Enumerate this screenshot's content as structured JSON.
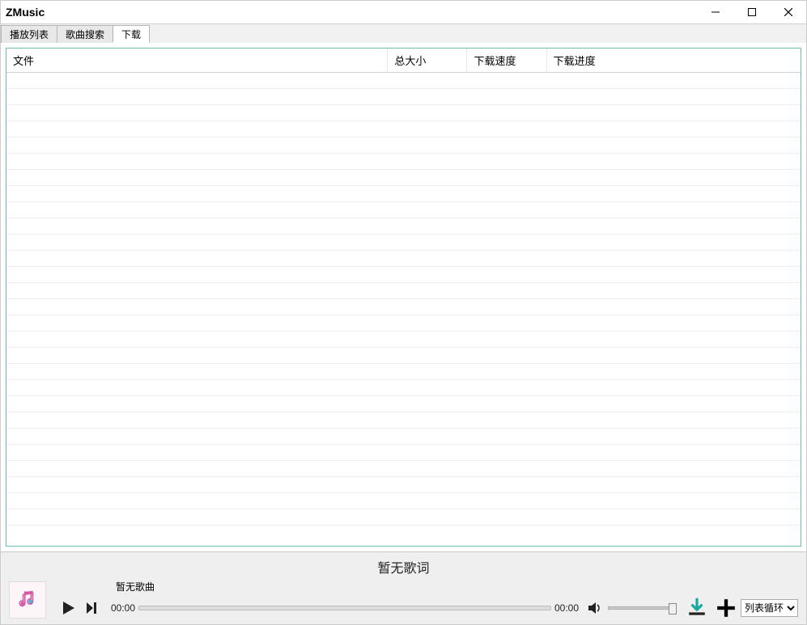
{
  "window": {
    "title": "ZMusic"
  },
  "tabs": {
    "playlist": "播放列表",
    "search": "歌曲搜索",
    "download": "下载"
  },
  "table": {
    "headers": {
      "file": "文件",
      "size": "总大小",
      "speed": "下载速度",
      "progress": "下载进度"
    }
  },
  "player": {
    "lyrics": "暂无歌词",
    "song_title": "暂无歌曲",
    "time_current": "00:00",
    "time_total": "00:00",
    "loop_mode": "列表循环"
  }
}
